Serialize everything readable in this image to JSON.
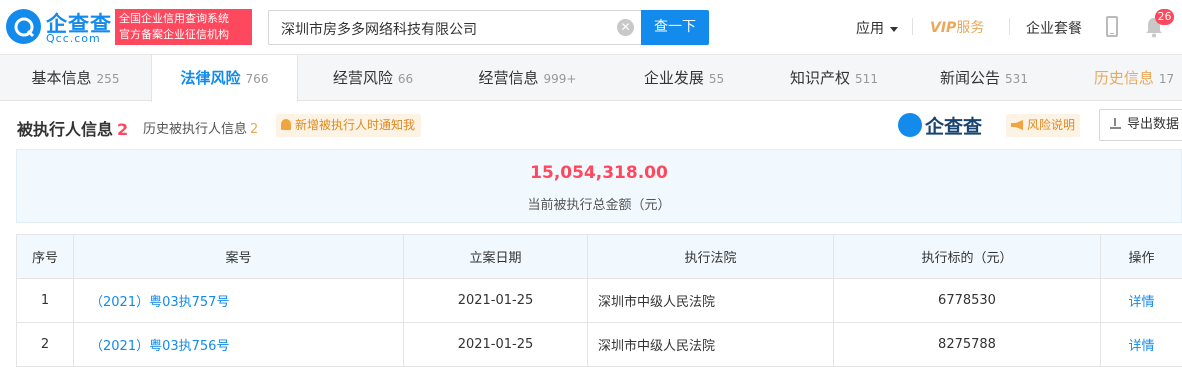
{
  "brand": {
    "name_cn": "企查查",
    "name_en": "Qcc.com",
    "slogan_line1": "全国企业信用查询系统",
    "slogan_line2": "官方备案企业征信机构"
  },
  "search": {
    "value": "深圳市房多多网络科技有限公司",
    "button_label": "查一下"
  },
  "nav": {
    "apps_label": "应用",
    "vip_prefix": "VIP",
    "vip_label": "服务",
    "suite_label": "企业套餐",
    "notification_count": "26"
  },
  "tabs": [
    {
      "label": "基本信息",
      "count": "255"
    },
    {
      "label": "法律风险",
      "count": "766"
    },
    {
      "label": "经营风险",
      "count": "66"
    },
    {
      "label": "经营信息",
      "count": "999+"
    },
    {
      "label": "企业发展",
      "count": "55"
    },
    {
      "label": "知识产权",
      "count": "511"
    },
    {
      "label": "新闻公告",
      "count": "531"
    },
    {
      "label": "历史信息",
      "count": "17"
    }
  ],
  "section": {
    "title": "被执行人信息",
    "count": "2",
    "history_label": "历史被执行人信息",
    "history_count": "2",
    "notify_label": "新增被执行人时通知我",
    "watermark": "企查查",
    "risk_label": "风险说明",
    "export_label": "导出数据"
  },
  "summary": {
    "amount": "15,054,318.00",
    "label": "当前被执行总金额（元）"
  },
  "table": {
    "headers": {
      "index": "序号",
      "case_no": "案号",
      "date": "立案日期",
      "court": "执行法院",
      "amount": "执行标的（元）",
      "action": "操作"
    },
    "rows": [
      {
        "index": "1",
        "case_no": "（2021）粤03执757号",
        "date": "2021-01-25",
        "court": "深圳市中级人民法院",
        "amount": "6778530",
        "action": "详情"
      },
      {
        "index": "2",
        "case_no": "（2021）粤03执756号",
        "date": "2021-01-25",
        "court": "深圳市中级人民法院",
        "amount": "8275788",
        "action": "详情"
      }
    ]
  },
  "colors": {
    "primary": "#128bed",
    "danger": "#fd485e",
    "warning": "#e8a95b"
  }
}
